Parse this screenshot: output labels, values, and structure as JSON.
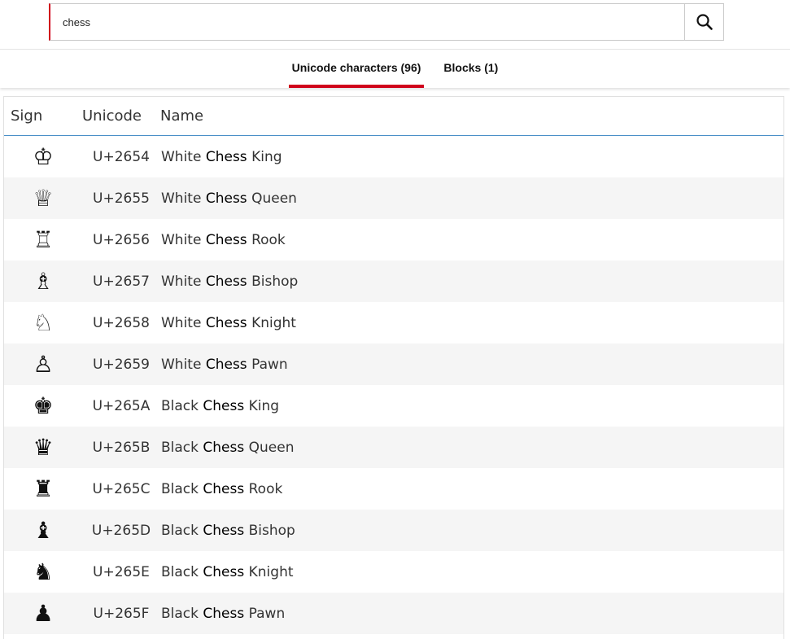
{
  "search": {
    "value": "chess",
    "placeholder": "",
    "button_icon": "search-icon"
  },
  "tabs": [
    {
      "label": "Unicode characters (96)",
      "active": true
    },
    {
      "label": "Blocks (1)",
      "active": false
    }
  ],
  "table": {
    "headers": {
      "sign": "Sign",
      "code": "Unicode",
      "name": "Name"
    },
    "rows": [
      {
        "sign": "♔",
        "code": "U+2654",
        "name_pre": "White ",
        "name_hl": "Chess",
        "name_post": " King"
      },
      {
        "sign": "♕",
        "code": "U+2655",
        "name_pre": "White ",
        "name_hl": "Chess",
        "name_post": " Queen"
      },
      {
        "sign": "♖",
        "code": "U+2656",
        "name_pre": "White ",
        "name_hl": "Chess",
        "name_post": " Rook"
      },
      {
        "sign": "♗",
        "code": "U+2657",
        "name_pre": "White ",
        "name_hl": "Chess",
        "name_post": " Bishop"
      },
      {
        "sign": "♘",
        "code": "U+2658",
        "name_pre": "White ",
        "name_hl": "Chess",
        "name_post": " Knight"
      },
      {
        "sign": "♙",
        "code": "U+2659",
        "name_pre": "White ",
        "name_hl": "Chess",
        "name_post": " Pawn"
      },
      {
        "sign": "♚",
        "code": "U+265A",
        "name_pre": "Black ",
        "name_hl": "Chess",
        "name_post": " King"
      },
      {
        "sign": "♛",
        "code": "U+265B",
        "name_pre": "Black ",
        "name_hl": "Chess",
        "name_post": " Queen"
      },
      {
        "sign": "♜",
        "code": "U+265C",
        "name_pre": "Black ",
        "name_hl": "Chess",
        "name_post": " Rook"
      },
      {
        "sign": "♝",
        "code": "U+265D",
        "name_pre": "Black ",
        "name_hl": "Chess",
        "name_post": " Bishop"
      },
      {
        "sign": "♞",
        "code": "U+265E",
        "name_pre": "Black ",
        "name_hl": "Chess",
        "name_post": " Knight"
      },
      {
        "sign": "♟",
        "code": "U+265F",
        "name_pre": "Black ",
        "name_hl": "Chess",
        "name_post": " Pawn"
      }
    ]
  },
  "colors": {
    "accent": "#d0021b",
    "header_rule": "#4a90c8",
    "row_alt": "#f5f5f5"
  }
}
